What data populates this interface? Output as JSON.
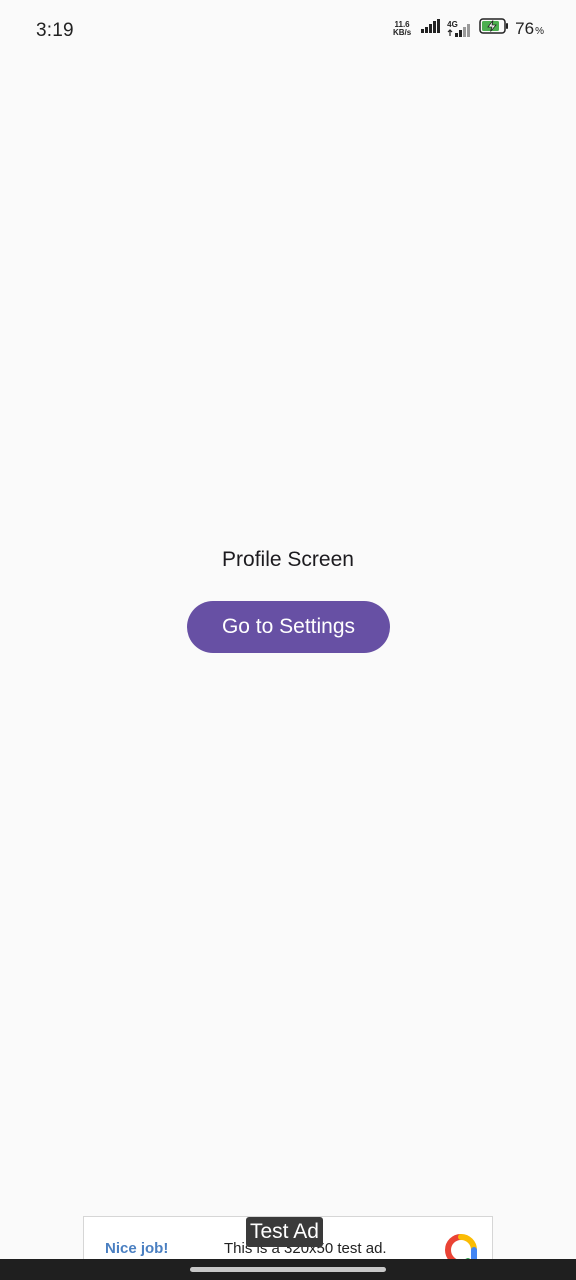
{
  "status_bar": {
    "time": "3:19",
    "net_speed_value": "11.6",
    "net_speed_unit": "KB/s",
    "network_type": "4G",
    "battery_percent": "76",
    "battery_percent_sign": "%",
    "icons": [
      "signal-icon",
      "signal-4g-icon",
      "battery-charging-icon"
    ]
  },
  "main": {
    "title": "Profile Screen",
    "settings_button_label": "Go to Settings"
  },
  "ad": {
    "badge": "Test Ad",
    "nice_job": "Nice job!",
    "message": "This is a 320x50 test ad.",
    "icon": "admob-logo-icon"
  },
  "colors": {
    "background": "#fafafa",
    "button": "#6750a4",
    "button_text": "#ffffff",
    "ad_link": "#4a7fc1",
    "battery": "#4caf50"
  }
}
